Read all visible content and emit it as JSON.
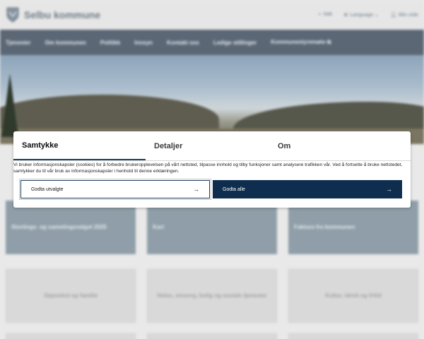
{
  "header": {
    "logo_text": "Selbu kommune",
    "search_label": "Søk",
    "language_label": "Language",
    "my_page_label": "Min side"
  },
  "nav": {
    "items": [
      {
        "label": "Tjenester"
      },
      {
        "label": "Om kommunen"
      },
      {
        "label": "Politikk"
      },
      {
        "label": "Innsyn"
      },
      {
        "label": "Kontakt oss"
      },
      {
        "label": "Ledige stillinger"
      },
      {
        "label": "Kommunestyremøte ⧉"
      }
    ]
  },
  "tiles": [
    {
      "label": "Stortings- og sametingsvalget 2025"
    },
    {
      "label": "Kart"
    },
    {
      "label": "Fakturа fra kommunen"
    },
    {
      "label": "Oppvekst og familie"
    },
    {
      "label": "Helse, omsorg, bolig og sosiale tjenester"
    },
    {
      "label": "Kultur, idrett og fritid"
    }
  ],
  "cookie_dialog": {
    "tabs": [
      {
        "label": "Samtykke",
        "active": true
      },
      {
        "label": "Detaljer",
        "active": false
      },
      {
        "label": "Om",
        "active": false
      }
    ],
    "text": "Vi bruker informasjonskapsler (cookies) for å forbedre brukeropplevelsen på vårt nettsted, tilpasse innhold og tilby funksjoner samt analysere trafikken vår. Ved å fortsette å bruke nettstedet, samtykker du til vår bruk av informasjonskapsler i henhold til denne erklæringen.",
    "accept_selected_label": "Godta utvalgte",
    "accept_all_label": "Godta alle"
  },
  "colors": {
    "primary": "#0f2d4f",
    "nav_bg": "#5b6775",
    "tile_dark": "#8f9ea8"
  }
}
